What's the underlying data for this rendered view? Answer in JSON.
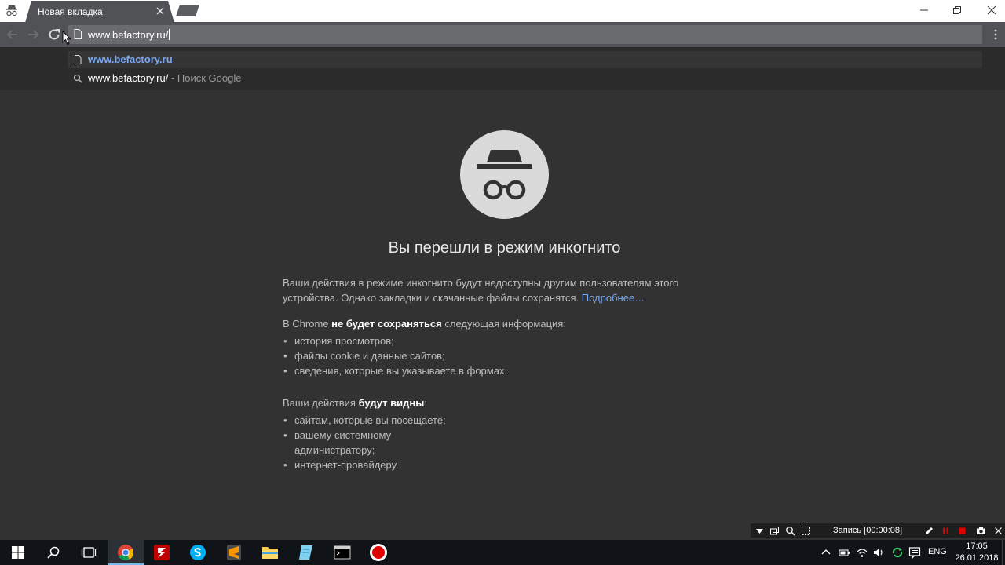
{
  "browser": {
    "tab": {
      "title": "Новая вкладка"
    },
    "omnibox": {
      "value": "www.befactory.ru/"
    },
    "suggestions": [
      {
        "icon": "page-icon",
        "text": "www.befactory.ru"
      },
      {
        "icon": "search-icon",
        "text": "www.befactory.ru/",
        "suffix": " - Поиск Google"
      }
    ]
  },
  "incognito": {
    "heading": "Вы перешли в режим инкогнито",
    "intro": "Ваши действия в режиме инкогнито будут недоступны другим пользователям этого устройства. Однако закладки и скачанные файлы сохранятся.",
    "learn_more": "Подробнее…",
    "not_saved": {
      "pre": "В Chrome ",
      "bold": "не будет сохраняться",
      "post": " следующая информация:",
      "items": [
        "история просмотров;",
        "файлы cookie и данные сайтов;",
        "сведения, которые вы указываете в формах."
      ]
    },
    "visible": {
      "pre": "Ваши действия ",
      "bold": "будут видны",
      "post": ":",
      "items": [
        "сайтам, которые вы посещаете;",
        "вашему системному администратору;",
        "интернет-провайдеру."
      ]
    }
  },
  "recorder": {
    "status": "Запись [00:00:08]"
  },
  "taskbar": {
    "apps": [
      "windows-start",
      "search",
      "task-view",
      "chrome",
      "filezilla",
      "skype",
      "sublime-text",
      "file-explorer",
      "notepad",
      "terminal",
      "recorder"
    ],
    "language": "ENG",
    "time": "17:05",
    "date": "26.01.2018"
  },
  "colors": {
    "accent": "#7aa7f1",
    "toolbar": "#505256",
    "page_bg": "#323232"
  }
}
